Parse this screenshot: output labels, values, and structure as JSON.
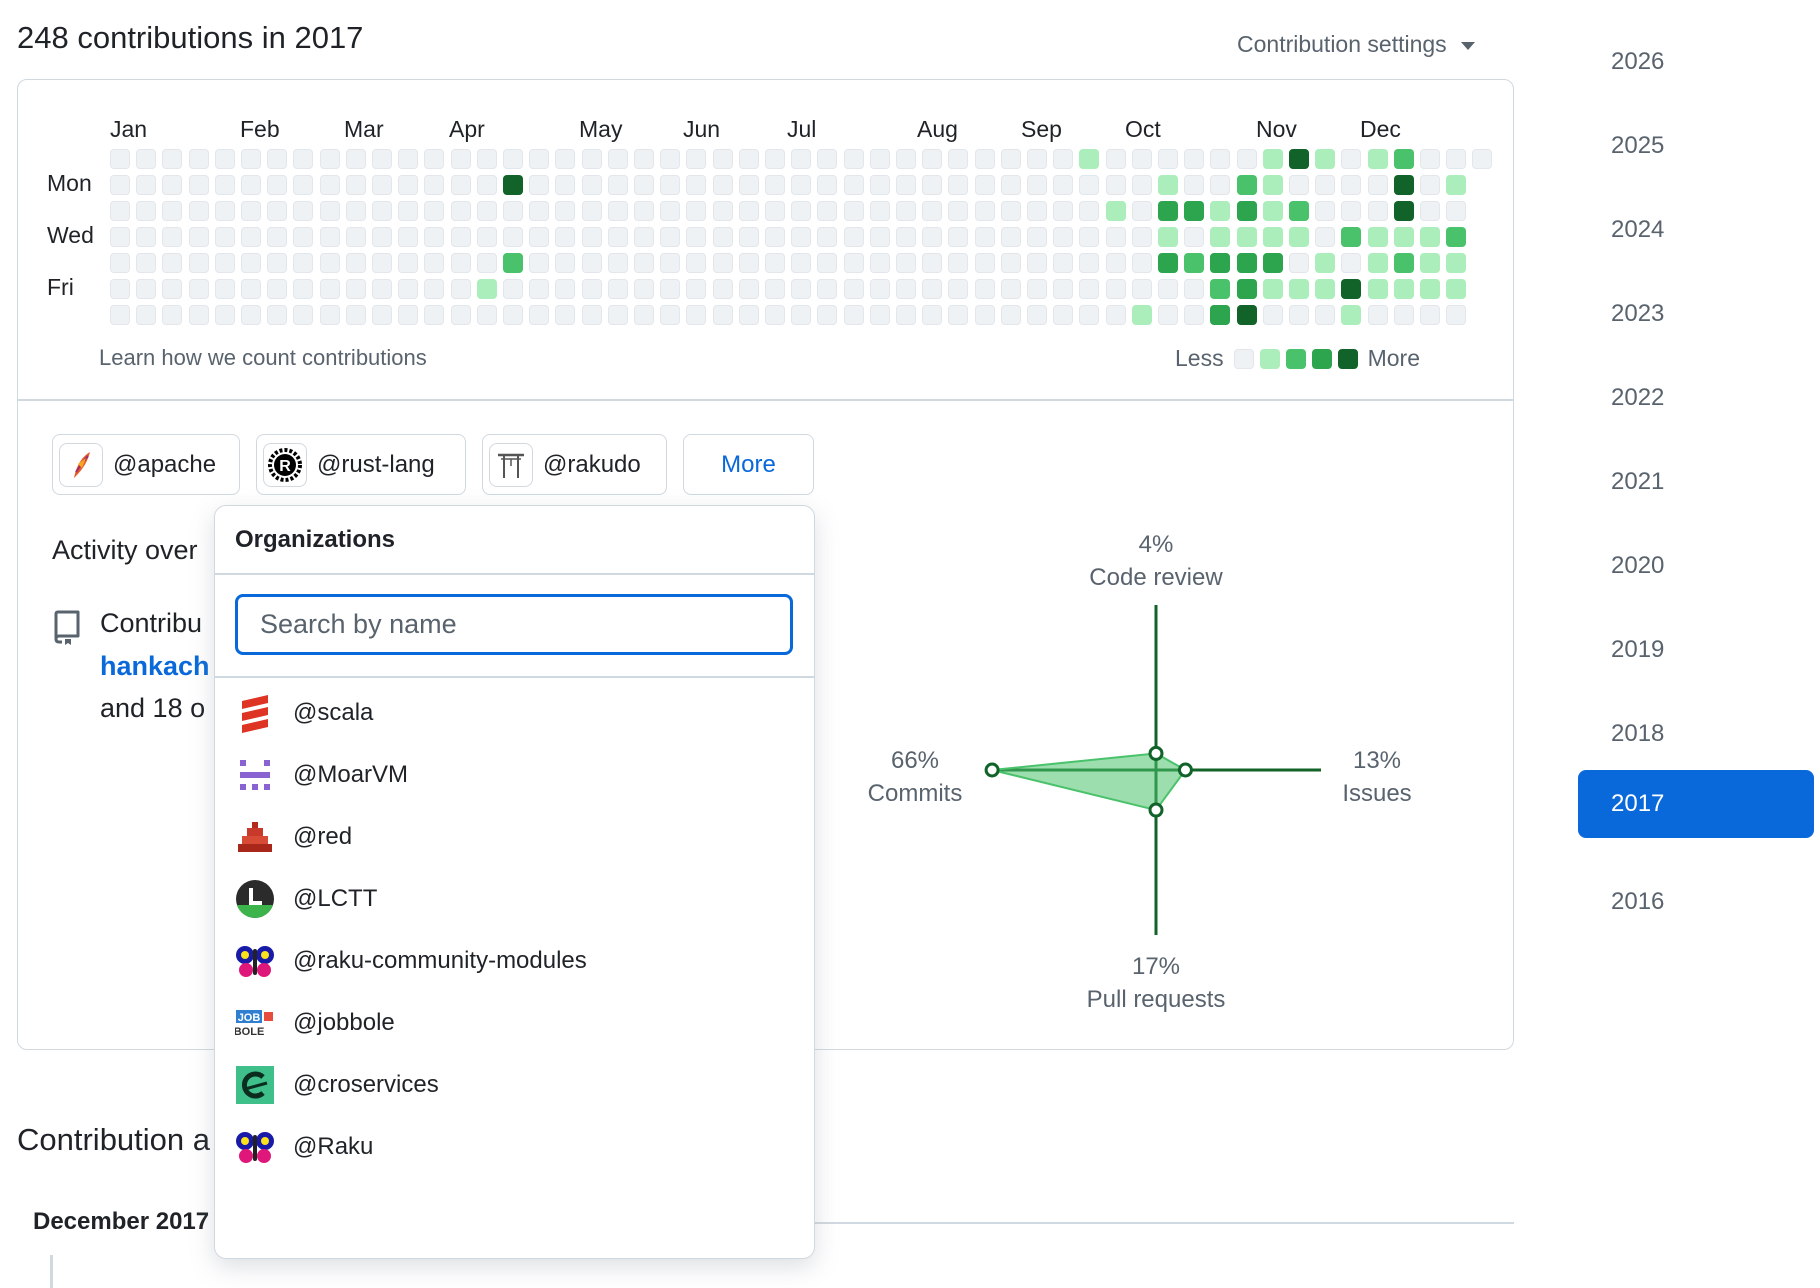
{
  "header": {
    "title": "248 contributions in 2017",
    "settings_label": "Contribution settings"
  },
  "calendar": {
    "months": [
      "Jan",
      "Feb",
      "Mar",
      "Apr",
      "May",
      "Jun",
      "Jul",
      "Aug",
      "Sep",
      "Oct",
      "Nov",
      "Dec"
    ],
    "days": [
      "Mon",
      "Wed",
      "Fri"
    ],
    "learn_link": "Learn how we count contributions",
    "legend_less": "Less",
    "legend_more": "More",
    "colors": [
      "#eff2f5",
      "#aceebb",
      "#4ac26b",
      "#2da44e",
      "#116329"
    ],
    "active_cells": [
      {
        "week": 37,
        "day": 0,
        "level": 1
      },
      {
        "week": 44,
        "day": 0,
        "level": 1
      },
      {
        "week": 45,
        "day": 0,
        "level": 4
      },
      {
        "week": 46,
        "day": 0,
        "level": 1
      },
      {
        "week": 48,
        "day": 0,
        "level": 1
      },
      {
        "week": 49,
        "day": 0,
        "level": 2
      },
      {
        "week": 15,
        "day": 1,
        "level": 4
      },
      {
        "week": 40,
        "day": 1,
        "level": 1
      },
      {
        "week": 43,
        "day": 1,
        "level": 2
      },
      {
        "week": 44,
        "day": 1,
        "level": 1
      },
      {
        "week": 49,
        "day": 1,
        "level": 4
      },
      {
        "week": 51,
        "day": 1,
        "level": 1
      },
      {
        "week": 38,
        "day": 2,
        "level": 1
      },
      {
        "week": 40,
        "day": 2,
        "level": 3
      },
      {
        "week": 41,
        "day": 2,
        "level": 3
      },
      {
        "week": 42,
        "day": 2,
        "level": 1
      },
      {
        "week": 43,
        "day": 2,
        "level": 3
      },
      {
        "week": 44,
        "day": 2,
        "level": 1
      },
      {
        "week": 45,
        "day": 2,
        "level": 2
      },
      {
        "week": 49,
        "day": 2,
        "level": 4
      },
      {
        "week": 40,
        "day": 3,
        "level": 1
      },
      {
        "week": 42,
        "day": 3,
        "level": 1
      },
      {
        "week": 43,
        "day": 3,
        "level": 1
      },
      {
        "week": 44,
        "day": 3,
        "level": 1
      },
      {
        "week": 45,
        "day": 3,
        "level": 1
      },
      {
        "week": 47,
        "day": 3,
        "level": 2
      },
      {
        "week": 48,
        "day": 3,
        "level": 1
      },
      {
        "week": 49,
        "day": 3,
        "level": 1
      },
      {
        "week": 50,
        "day": 3,
        "level": 1
      },
      {
        "week": 51,
        "day": 3,
        "level": 2
      },
      {
        "week": 15,
        "day": 4,
        "level": 2
      },
      {
        "week": 40,
        "day": 4,
        "level": 3
      },
      {
        "week": 41,
        "day": 4,
        "level": 2
      },
      {
        "week": 42,
        "day": 4,
        "level": 3
      },
      {
        "week": 43,
        "day": 4,
        "level": 3
      },
      {
        "week": 44,
        "day": 4,
        "level": 3
      },
      {
        "week": 46,
        "day": 4,
        "level": 1
      },
      {
        "week": 48,
        "day": 4,
        "level": 1
      },
      {
        "week": 49,
        "day": 4,
        "level": 2
      },
      {
        "week": 50,
        "day": 4,
        "level": 1
      },
      {
        "week": 51,
        "day": 4,
        "level": 1
      },
      {
        "week": 14,
        "day": 5,
        "level": 1
      },
      {
        "week": 42,
        "day": 5,
        "level": 2
      },
      {
        "week": 43,
        "day": 5,
        "level": 3
      },
      {
        "week": 44,
        "day": 5,
        "level": 1
      },
      {
        "week": 45,
        "day": 5,
        "level": 1
      },
      {
        "week": 46,
        "day": 5,
        "level": 1
      },
      {
        "week": 47,
        "day": 5,
        "level": 4
      },
      {
        "week": 48,
        "day": 5,
        "level": 1
      },
      {
        "week": 49,
        "day": 5,
        "level": 1
      },
      {
        "week": 50,
        "day": 5,
        "level": 1
      },
      {
        "week": 51,
        "day": 5,
        "level": 1
      },
      {
        "week": 39,
        "day": 6,
        "level": 1
      },
      {
        "week": 42,
        "day": 6,
        "level": 3
      },
      {
        "week": 43,
        "day": 6,
        "level": 4
      },
      {
        "week": 47,
        "day": 6,
        "level": 1
      }
    ]
  },
  "orgs": [
    {
      "name": "@apache",
      "icon": "apache-feather-icon"
    },
    {
      "name": "@rust-lang",
      "icon": "rust-logo-icon"
    },
    {
      "name": "@rakudo",
      "icon": "rakudo-gate-icon"
    }
  ],
  "more_button": "More",
  "activity": {
    "title": "Activity over",
    "contributed": "Contribu",
    "repo_link": "hankach",
    "others": "and 18 o"
  },
  "radar": {
    "code_review_pct": "4%",
    "code_review_label": "Code review",
    "commits_pct": "66%",
    "commits_label": "Commits",
    "issues_pct": "13%",
    "issues_label": "Issues",
    "prs_pct": "17%",
    "prs_label": "Pull requests",
    "values": {
      "code_review": 4,
      "commits": 66,
      "issues": 13,
      "pull_requests": 17
    },
    "line_color": "#116329",
    "fill_color": "#4ac26b"
  },
  "contribution_activity": {
    "title": "Contribution a",
    "month": "December 2017"
  },
  "years": [
    "2026",
    "2025",
    "2024",
    "2023",
    "2022",
    "2021",
    "2020",
    "2019",
    "2018",
    "2017",
    "2016"
  ],
  "active_year": "2017",
  "dropdown": {
    "title": "Organizations",
    "search_placeholder": "Search by name",
    "items": [
      {
        "name": "@scala",
        "icon": "scala-logo-icon"
      },
      {
        "name": "@MoarVM",
        "icon": "moarvm-logo-icon"
      },
      {
        "name": "@red",
        "icon": "red-pyramid-icon"
      },
      {
        "name": "@LCTT",
        "icon": "lctt-logo-icon"
      },
      {
        "name": "@raku-community-modules",
        "icon": "camelia-butterfly-icon"
      },
      {
        "name": "@jobbole",
        "icon": "jobbole-logo-icon"
      },
      {
        "name": "@croservices",
        "icon": "cro-logo-icon"
      },
      {
        "name": "@Raku",
        "icon": "camelia-butterfly-icon"
      }
    ]
  }
}
